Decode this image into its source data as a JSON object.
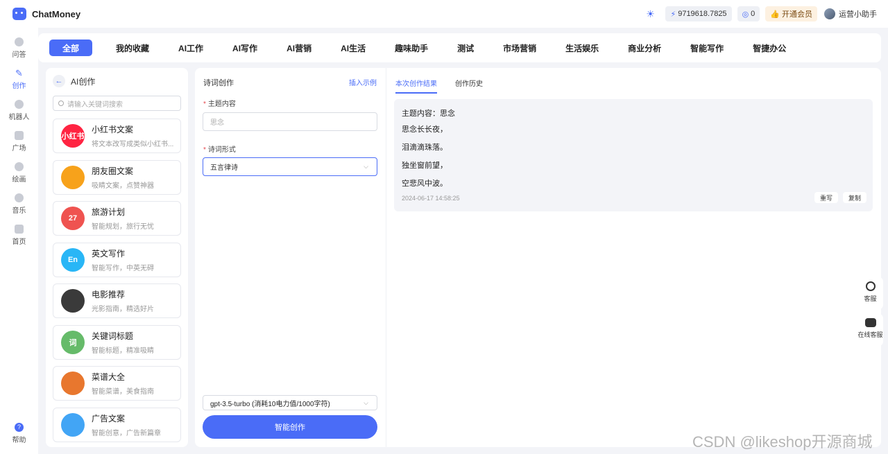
{
  "app": {
    "name": "ChatMoney"
  },
  "header": {
    "balance": "9719618.7825",
    "tokens": "0",
    "vip_label": "开通会员",
    "user_name": "运营小助手"
  },
  "rail": [
    {
      "label": "问答",
      "icon": "chat-icon"
    },
    {
      "label": "创作",
      "icon": "pen-icon"
    },
    {
      "label": "机器人",
      "icon": "robot-icon"
    },
    {
      "label": "广场",
      "icon": "grid-icon"
    },
    {
      "label": "绘画",
      "icon": "palette-icon"
    },
    {
      "label": "音乐",
      "icon": "music-icon"
    },
    {
      "label": "首页",
      "icon": "home-icon"
    },
    {
      "label": "帮助",
      "icon": "help-icon"
    }
  ],
  "categories": [
    "全部",
    "我的收藏",
    "AI工作",
    "AI写作",
    "AI营销",
    "AI生活",
    "趣味助手",
    "测试",
    "市场营销",
    "生活娱乐",
    "商业分析",
    "智能写作",
    "智捷办公"
  ],
  "tools_panel": {
    "title": "AI创作",
    "search_placeholder": "请输入关键词搜索",
    "items": [
      {
        "name": "小红书文案",
        "desc": "将文本改写成类似小红书...",
        "icon": "xiaohongshu-icon",
        "icon_text": "小红书",
        "color": "#ff2442"
      },
      {
        "name": "朋友圈文案",
        "desc": "吸睛文案，点赞神器",
        "icon": "aperture-icon",
        "icon_text": "",
        "color": "#f7a21b"
      },
      {
        "name": "旅游计划",
        "desc": "智能规划，旅行无忧",
        "icon": "calendar-icon",
        "icon_text": "27",
        "color": "#ef5350"
      },
      {
        "name": "英文写作",
        "desc": "智能写作，中英无碍",
        "icon": "english-icon",
        "icon_text": "En",
        "color": "#29b6f6"
      },
      {
        "name": "电影推荐",
        "desc": "光影指南，精选好片",
        "icon": "clapperboard-icon",
        "icon_text": "",
        "color": "#3a3a3a"
      },
      {
        "name": "关键词标题",
        "desc": "智能标题，精准吸睛",
        "icon": "keyword-icon",
        "icon_text": "词",
        "color": "#66bb6a"
      },
      {
        "name": "菜谱大全",
        "desc": "智能菜谱，美食指南",
        "icon": "wok-icon",
        "icon_text": "",
        "color": "#e8772e"
      },
      {
        "name": "广告文案",
        "desc": "智能创意，广告新篇章",
        "icon": "bulb-icon",
        "icon_text": "",
        "color": "#42a5f5"
      }
    ]
  },
  "form": {
    "title": "诗词创作",
    "insert_example": "插入示例",
    "topic_label": "主题内容",
    "topic_placeholder": "思念",
    "style_label": "诗词形式",
    "style_value": "五言律诗",
    "model_value": "gpt-3.5-turbo (消耗10电力值/1000字符)",
    "submit_label": "智能创作"
  },
  "result": {
    "tabs": [
      "本次创作结果",
      "创作历史"
    ],
    "lines": [
      "主题内容：思念",
      "思念长长夜，",
      "泪滴滴珠落。",
      "独坐窗前望，",
      "空悲风中波。"
    ],
    "timestamp": "2024-06-17 14:58:25",
    "rewrite_label": "重写",
    "copy_label": "复制"
  },
  "service": {
    "support_label": "客服",
    "online_label": "在线客服"
  },
  "watermark": "CSDN @likeshop开源商城",
  "colors": {
    "accent": "#4a6cf7",
    "background": "#f3f4f8"
  }
}
